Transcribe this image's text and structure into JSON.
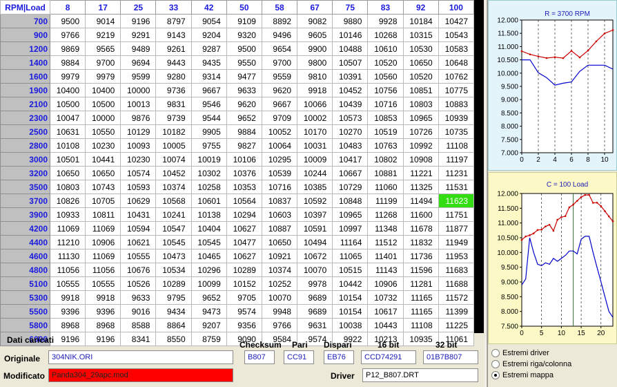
{
  "grid": {
    "corner_label": "RPM|Load",
    "loads": [
      "8",
      "17",
      "25",
      "33",
      "42",
      "50",
      "58",
      "67",
      "75",
      "83",
      "92",
      "100"
    ],
    "highlight": {
      "row": 13,
      "col": 11,
      "color": "#33dd11"
    },
    "rows": [
      {
        "rpm": "700",
        "values": [
          "9500",
          "9014",
          "9196",
          "8797",
          "9054",
          "9109",
          "8892",
          "9082",
          "9880",
          "9928",
          "10184",
          "10427"
        ]
      },
      {
        "rpm": "900",
        "values": [
          "9766",
          "9219",
          "9291",
          "9143",
          "9204",
          "9320",
          "9496",
          "9605",
          "10146",
          "10268",
          "10315",
          "10543"
        ]
      },
      {
        "rpm": "1200",
        "values": [
          "9869",
          "9565",
          "9489",
          "9261",
          "9287",
          "9500",
          "9654",
          "9900",
          "10488",
          "10610",
          "10530",
          "10583"
        ]
      },
      {
        "rpm": "1400",
        "values": [
          "9884",
          "9700",
          "9694",
          "9443",
          "9435",
          "9550",
          "9700",
          "9800",
          "10507",
          "10520",
          "10650",
          "10648"
        ]
      },
      {
        "rpm": "1600",
        "values": [
          "9979",
          "9979",
          "9599",
          "9280",
          "9314",
          "9477",
          "9559",
          "9810",
          "10391",
          "10560",
          "10520",
          "10762"
        ]
      },
      {
        "rpm": "1900",
        "values": [
          "10400",
          "10400",
          "10000",
          "9736",
          "9667",
          "9633",
          "9620",
          "9918",
          "10452",
          "10756",
          "10851",
          "10775"
        ]
      },
      {
        "rpm": "2100",
        "values": [
          "10500",
          "10500",
          "10013",
          "9831",
          "9546",
          "9620",
          "9667",
          "10066",
          "10439",
          "10716",
          "10803",
          "10883"
        ]
      },
      {
        "rpm": "2300",
        "values": [
          "10047",
          "10000",
          "9876",
          "9739",
          "9544",
          "9652",
          "9709",
          "10002",
          "10573",
          "10853",
          "10965",
          "10939"
        ]
      },
      {
        "rpm": "2500",
        "values": [
          "10631",
          "10550",
          "10129",
          "10182",
          "9905",
          "9884",
          "10052",
          "10170",
          "10270",
          "10519",
          "10726",
          "10735"
        ]
      },
      {
        "rpm": "2800",
        "values": [
          "10108",
          "10230",
          "10093",
          "10005",
          "9755",
          "9827",
          "10064",
          "10031",
          "10483",
          "10763",
          "10992",
          "11108"
        ]
      },
      {
        "rpm": "3000",
        "values": [
          "10501",
          "10441",
          "10230",
          "10074",
          "10019",
          "10106",
          "10295",
          "10009",
          "10417",
          "10802",
          "10908",
          "11197"
        ]
      },
      {
        "rpm": "3200",
        "values": [
          "10650",
          "10650",
          "10574",
          "10452",
          "10302",
          "10376",
          "10539",
          "10244",
          "10667",
          "10881",
          "11221",
          "11231"
        ]
      },
      {
        "rpm": "3500",
        "values": [
          "10803",
          "10743",
          "10593",
          "10374",
          "10258",
          "10353",
          "10716",
          "10385",
          "10729",
          "11060",
          "11325",
          "11531"
        ]
      },
      {
        "rpm": "3700",
        "values": [
          "10826",
          "10705",
          "10629",
          "10568",
          "10601",
          "10564",
          "10837",
          "10592",
          "10848",
          "11199",
          "11494",
          "11623"
        ]
      },
      {
        "rpm": "3900",
        "values": [
          "10933",
          "10811",
          "10431",
          "10241",
          "10138",
          "10294",
          "10603",
          "10397",
          "10965",
          "11268",
          "11600",
          "11751"
        ]
      },
      {
        "rpm": "4200",
        "values": [
          "11069",
          "11069",
          "10594",
          "10547",
          "10404",
          "10627",
          "10887",
          "10591",
          "10997",
          "11348",
          "11678",
          "11877"
        ]
      },
      {
        "rpm": "4400",
        "values": [
          "11210",
          "10906",
          "10621",
          "10545",
          "10545",
          "10477",
          "10650",
          "10494",
          "11164",
          "11512",
          "11832",
          "11949"
        ]
      },
      {
        "rpm": "4600",
        "values": [
          "11130",
          "11069",
          "10555",
          "10473",
          "10465",
          "10627",
          "10921",
          "10672",
          "11065",
          "11401",
          "11736",
          "11953"
        ]
      },
      {
        "rpm": "4800",
        "values": [
          "11056",
          "11056",
          "10676",
          "10534",
          "10296",
          "10289",
          "10374",
          "10070",
          "10515",
          "11143",
          "11596",
          "11683"
        ]
      },
      {
        "rpm": "5100",
        "values": [
          "10555",
          "10555",
          "10526",
          "10289",
          "10099",
          "10152",
          "10252",
          "9978",
          "10442",
          "10906",
          "11281",
          "11688"
        ]
      },
      {
        "rpm": "5300",
        "values": [
          "9918",
          "9918",
          "9633",
          "9795",
          "9652",
          "9705",
          "10070",
          "9689",
          "10154",
          "10732",
          "11165",
          "11572"
        ]
      },
      {
        "rpm": "5500",
        "values": [
          "9396",
          "9396",
          "9016",
          "9434",
          "9473",
          "9574",
          "9948",
          "9689",
          "10154",
          "10617",
          "11165",
          "11399"
        ]
      },
      {
        "rpm": "5800",
        "values": [
          "8968",
          "8968",
          "8588",
          "8864",
          "9207",
          "9356",
          "9766",
          "9631",
          "10038",
          "10443",
          "11108",
          "11225"
        ]
      },
      {
        "rpm": "6000",
        "values": [
          "9196",
          "9196",
          "8341",
          "8550",
          "8759",
          "9090",
          "9584",
          "9574",
          "9922",
          "10213",
          "10935",
          "11061"
        ]
      }
    ]
  },
  "info": {
    "section_title": "Dati caricati",
    "original_label": "Originale",
    "original_value": "304NIK.ORI",
    "modified_label": "Modificato",
    "modified_value": "Panda304_29apc.mod",
    "checksum_label": "Checksum",
    "checksum_value": "B807",
    "pari_label": "Pari",
    "pari_value": "CC91",
    "dispari_label": "Dispari",
    "dispari_value": "EB76",
    "bit16_label": "16 bit",
    "bit16_value": "CCD74291",
    "bit32_label": "32 bit",
    "bit32_value": "01B7B807",
    "driver_label": "Driver",
    "driver_value": "P12_B807.DRT"
  },
  "chart_data": [
    {
      "type": "line",
      "title": "R = 3700 RPM",
      "x": [
        0,
        1,
        2,
        3,
        4,
        5,
        6,
        7,
        8,
        9,
        10,
        11
      ],
      "series": [
        {
          "color": "#cc0000",
          "values": [
            10826,
            10705,
            10629,
            10568,
            10601,
            10564,
            10837,
            10592,
            10848,
            11199,
            11494,
            11623
          ]
        },
        {
          "color": "#0000cc",
          "values": [
            10500,
            10500,
            10013,
            9831,
            9546,
            9620,
            9667,
            10066,
            10300,
            10300,
            10300,
            10150
          ]
        }
      ],
      "xlim": [
        0,
        11
      ],
      "ylim": [
        7000,
        12000
      ],
      "yticks": [
        "12.000",
        "11.500",
        "11.000",
        "10.500",
        "10.000",
        "9.500",
        "9.000",
        "8.500",
        "8.000",
        "7.500",
        "7.000"
      ],
      "xticks": [
        "0",
        "2",
        "4",
        "6",
        "8",
        "10"
      ],
      "grid": "vertical dashed"
    },
    {
      "type": "line",
      "title": "C = 100 Load",
      "x": [
        0,
        1,
        2,
        3,
        4,
        5,
        6,
        7,
        8,
        9,
        10,
        11,
        12,
        13,
        14,
        15,
        16,
        17,
        18,
        19,
        20,
        21,
        22,
        23
      ],
      "series": [
        {
          "color": "#cc0000",
          "values": [
            10427,
            10543,
            10583,
            10648,
            10762,
            10775,
            10883,
            10939,
            10735,
            11108,
            11197,
            11231,
            11531,
            11623,
            11751,
            11877,
            11949,
            11953,
            11683,
            11688,
            11572,
            11399,
            11225,
            11061
          ]
        },
        {
          "color": "#0000cc",
          "values": [
            8900,
            9100,
            10500,
            10000,
            9600,
            9550,
            9650,
            9600,
            9800,
            9700,
            9800,
            9900,
            10050,
            10050,
            9950,
            10450,
            10550,
            10550,
            10000,
            9500,
            9000,
            8500,
            8000,
            7800
          ]
        }
      ],
      "cursor_x": 13,
      "xlim": [
        0,
        23
      ],
      "ylim": [
        7500,
        12000
      ],
      "yticks": [
        "12.000",
        "11.500",
        "11.000",
        "10.500",
        "10.000",
        "9.500",
        "9.000",
        "8.500",
        "8.000",
        "7.500"
      ],
      "xticks": [
        "0",
        "5",
        "10",
        "15",
        "20"
      ],
      "grid": "vertical dashed"
    }
  ],
  "radios": {
    "items": [
      "Estremi driver",
      "Estremi riga/colonna",
      "Estremi mappa"
    ],
    "selected": 2
  }
}
